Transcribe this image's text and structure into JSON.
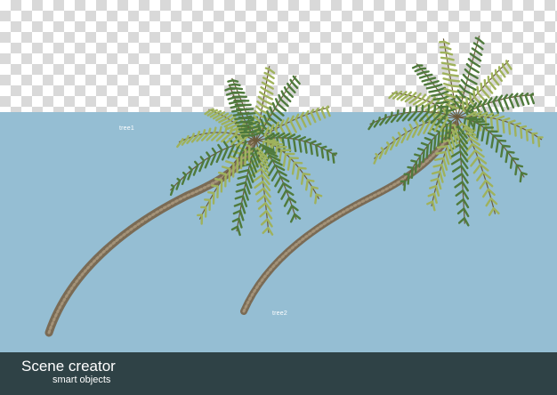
{
  "labels": {
    "tree1": "tree1",
    "tree2": "tree2"
  },
  "footer": {
    "title": "Scene creator",
    "subtitle": "smart objects"
  },
  "colors": {
    "sky": "#95bed3",
    "footer": "#2f4246",
    "frond_dark": "#4f7a3c",
    "frond_light": "#9fb25c",
    "trunk": "#8a7a62"
  }
}
